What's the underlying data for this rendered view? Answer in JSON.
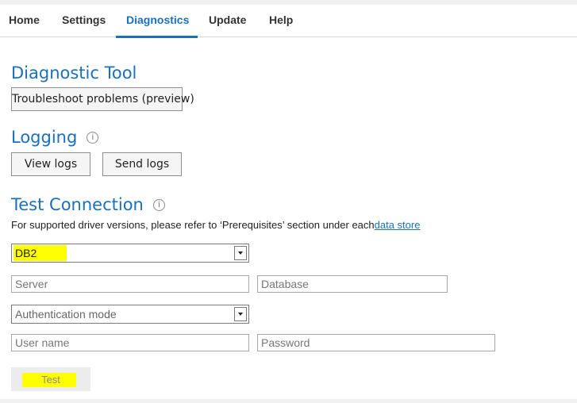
{
  "tabs": [
    {
      "label": "Home"
    },
    {
      "label": "Settings"
    },
    {
      "label": "Diagnostics",
      "active": true
    },
    {
      "label": "Update"
    },
    {
      "label": "Help"
    }
  ],
  "diagnostic": {
    "title": "Diagnostic Tool",
    "troubleshoot_label": "Troubleshoot problems (preview)"
  },
  "logging": {
    "title": "Logging",
    "info_glyph": "i",
    "view_logs_label": "View logs",
    "send_logs_label": "Send logs"
  },
  "test_connection": {
    "title": "Test Connection",
    "info_glyph": "i",
    "description": "For supported driver versions, please refer to ‘Prerequisites’ section under each",
    "link_text": "data store",
    "data_store_value": "DB2",
    "server_placeholder": "Server",
    "database_placeholder": "Database",
    "auth_mode_value": "Authentication mode",
    "username_placeholder": "User name",
    "password_placeholder": "Password",
    "test_label": "Test"
  },
  "colors": {
    "accent": "#1a6fbf",
    "highlight": "#ffff00"
  },
  "icons": {
    "info": "info-circle-icon",
    "dropdown": "chevron-down-icon"
  }
}
